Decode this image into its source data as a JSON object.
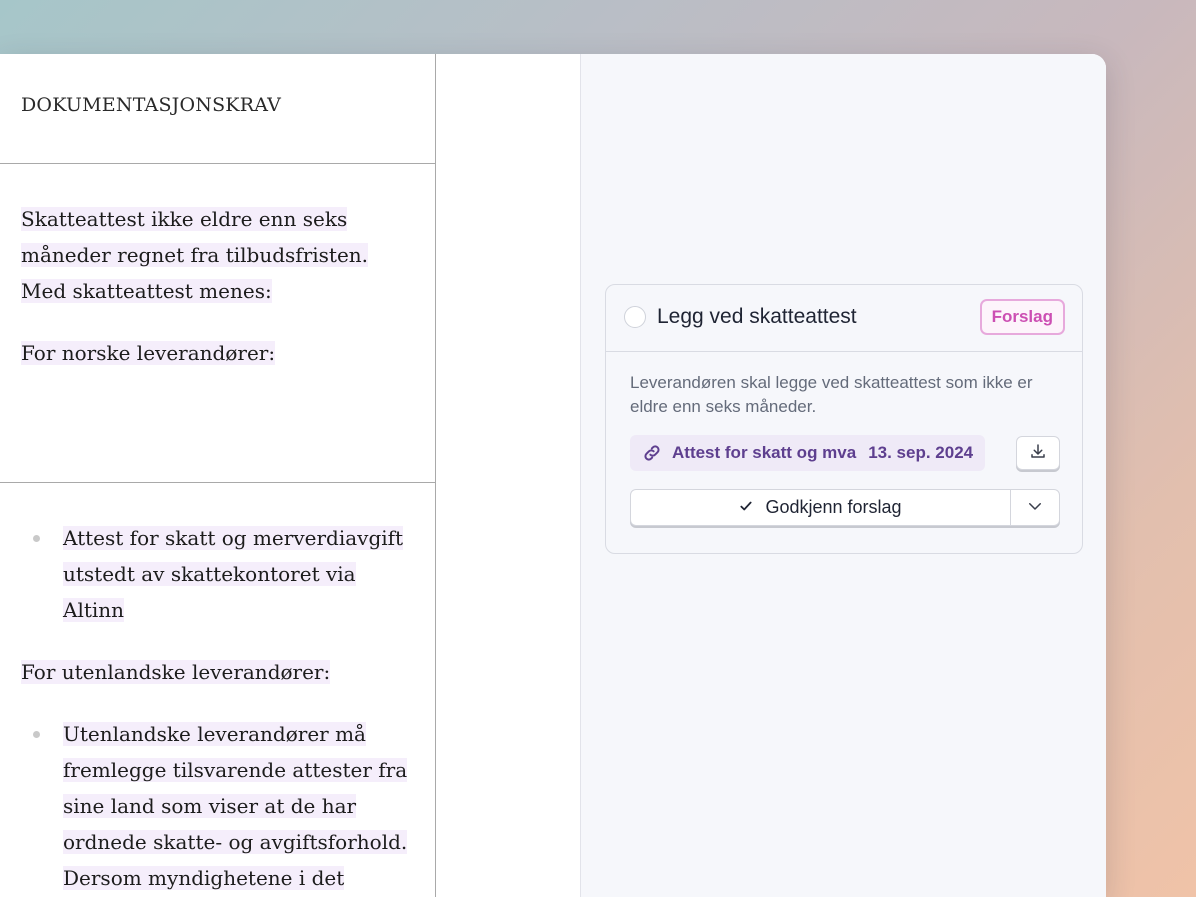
{
  "document": {
    "header_title": "DOKUMENTASJONSKRAV",
    "section1": {
      "intro": "Skatteattest ikke eldre enn seks måneder regnet fra tilbudsfristen. Med skatteattest menes:",
      "norwegian_label": "For norske leverandører:"
    },
    "section2": {
      "bullet1": "Attest for skatt og merverdiavgift utstedt av skattekontoret via Altinn",
      "foreign_label": "For utenlandske leverandører:",
      "bullet2": "Utenlandske leverandører må fremlegge tilsvarende attester fra sine land som viser at de har ordnede skatte- og avgiftsforhold. Dersom myndighetene i det aktuelle landet ikke utsteder slike"
    }
  },
  "suggestion_card": {
    "title": "Legg ved skatteattest",
    "badge": "Forslag",
    "description": "Leverandøren skal legge ved skatteattest som ikke er eldre enn seks måneder.",
    "attachment_name": "Attest for skatt og mva",
    "attachment_date": "13. sep. 2024",
    "approve_label": "Godkjenn forslag",
    "icons": {
      "attachment": "paperclip-icon",
      "download": "download-icon",
      "check": "check-icon",
      "dropdown": "chevron-down-icon"
    }
  },
  "colors": {
    "accent_purple": "#5e3f8f",
    "badge_pink": "#cc4fb3",
    "highlight": "#f5eefb"
  }
}
